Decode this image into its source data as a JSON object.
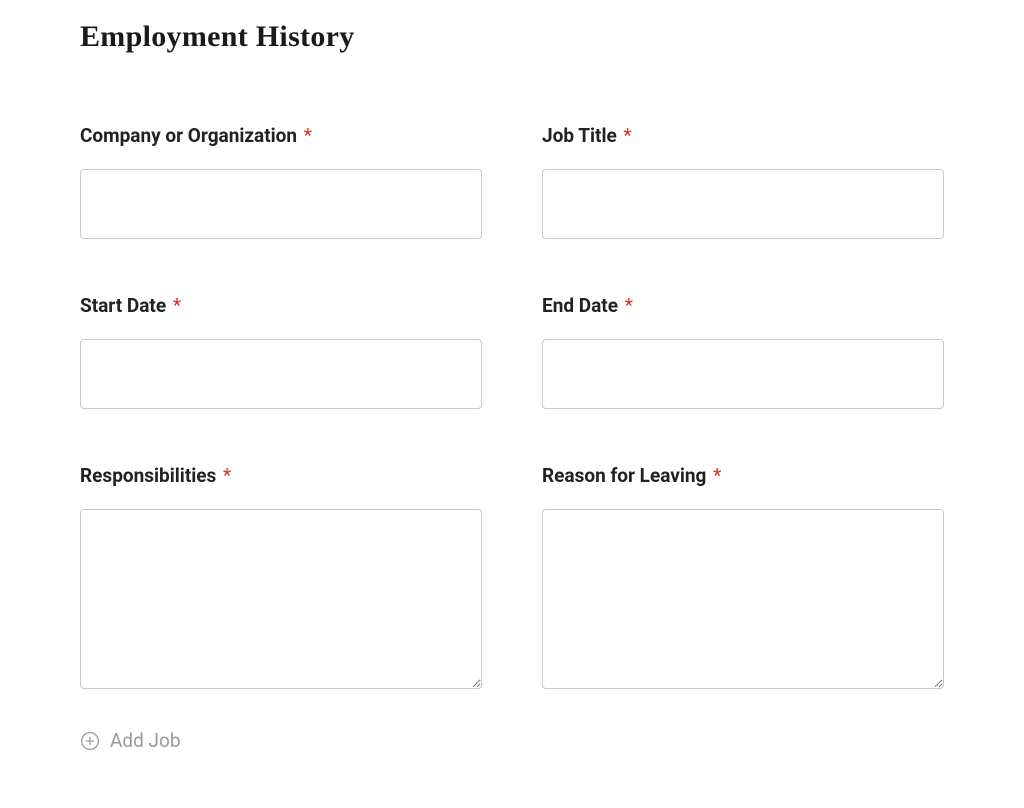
{
  "section": {
    "title": "Employment History"
  },
  "fields": {
    "company": {
      "label": "Company or Organization",
      "value": "",
      "required": "*"
    },
    "job_title": {
      "label": "Job Title",
      "value": "",
      "required": "*"
    },
    "start_date": {
      "label": "Start Date",
      "value": "",
      "required": "*"
    },
    "end_date": {
      "label": "End Date",
      "value": "",
      "required": "*"
    },
    "responsibilities": {
      "label": "Responsibilities",
      "value": "",
      "required": "*"
    },
    "reason_leaving": {
      "label": "Reason for Leaving",
      "value": "",
      "required": "*"
    }
  },
  "add_job": {
    "label": "Add Job"
  }
}
